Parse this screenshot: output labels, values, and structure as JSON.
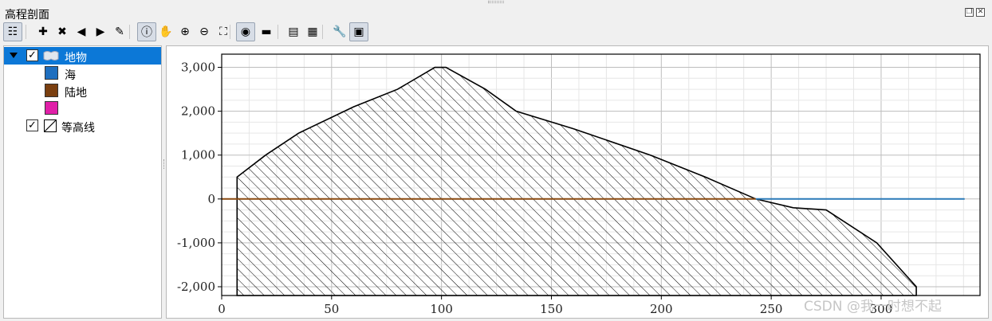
{
  "window": {
    "title": "高程剖面",
    "float_icon": "restore-icon",
    "close_icon": "close-icon"
  },
  "toolbar": {
    "buttons": [
      {
        "name": "layer-tree-icon",
        "glyph": "☷",
        "active": true
      },
      {
        "name": "add-layer-icon",
        "glyph": "✚"
      },
      {
        "name": "remove-layer-icon",
        "glyph": "✖"
      },
      {
        "name": "back-icon",
        "glyph": "◀"
      },
      {
        "name": "forward-icon",
        "glyph": "▶"
      },
      {
        "name": "clear-icon",
        "glyph": "✎"
      },
      {
        "name": "identify-icon",
        "glyph": "ⓘ",
        "active": true
      },
      {
        "name": "pan-icon",
        "glyph": "✋"
      },
      {
        "name": "zoom-in-icon",
        "glyph": "⊕"
      },
      {
        "name": "zoom-out-icon",
        "glyph": "⊖"
      },
      {
        "name": "zoom-full-icon",
        "glyph": "⛶"
      },
      {
        "name": "snap-icon",
        "glyph": "◉",
        "active": true
      },
      {
        "name": "measure-icon",
        "glyph": "▬"
      },
      {
        "name": "export-pdf-icon",
        "glyph": "▤"
      },
      {
        "name": "export-image-icon",
        "glyph": "▦"
      },
      {
        "name": "settings-icon",
        "glyph": "🔧"
      },
      {
        "name": "options-icon",
        "glyph": "▣",
        "active": true
      }
    ]
  },
  "layers": {
    "group": {
      "label": "地物",
      "checked": "✓"
    },
    "classes": [
      {
        "label": "海",
        "color": "#1f6fbf"
      },
      {
        "label": "陆地",
        "color": "#7a3f10"
      },
      {
        "label": "",
        "color": "#e020a8"
      }
    ],
    "contour": {
      "label": "等高线",
      "checked": "✓"
    }
  },
  "chart_data": {
    "type": "area",
    "xlim": [
      0,
      345
    ],
    "ylim": [
      -2200,
      3300
    ],
    "xticks": [
      0,
      50,
      100,
      150,
      200,
      250,
      300
    ],
    "xtick_labels": [
      "0",
      "50",
      "100",
      "150",
      "200",
      "250",
      "300"
    ],
    "yticks": [
      3000,
      2000,
      1000,
      0,
      -1000,
      -2000
    ],
    "ytick_labels": [
      "3,000",
      "2,000",
      "1,000",
      "0",
      "-1,000",
      "-2,000"
    ],
    "grid": true,
    "profile": {
      "x": [
        7,
        7,
        20,
        35,
        60,
        80,
        97,
        102,
        120,
        134,
        160,
        195,
        220,
        243,
        260,
        275,
        298,
        316,
        316
      ],
      "y": [
        -2200,
        500,
        1000,
        1500,
        2100,
        2500,
        3000,
        3000,
        2500,
        2000,
        1600,
        1000,
        500,
        0,
        -200,
        -250,
        -1000,
        -2000,
        -2200
      ],
      "fill": "hatch"
    },
    "line_land": {
      "color": "#8a4a10",
      "x": [
        0,
        243
      ],
      "y": [
        0,
        0
      ]
    },
    "line_sea": {
      "color": "#2a7ab8",
      "x": [
        243,
        338
      ],
      "y": [
        0,
        0
      ]
    }
  },
  "watermark": "CSDN @我一时想不起"
}
